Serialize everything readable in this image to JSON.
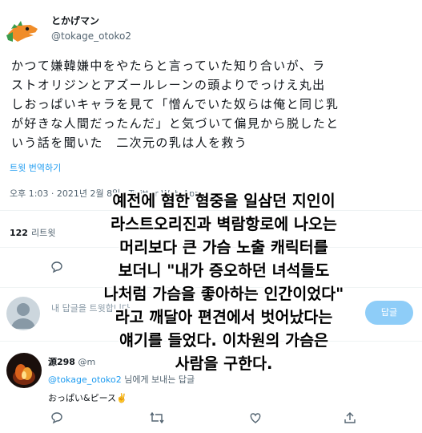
{
  "tweet": {
    "author_name": "とかげマン",
    "author_handle": "@tokage_otoko2",
    "text": "かつて嫌韓嫌中をやたらと言っていた知り合いが、ラ\nストオリジンとアズールレーンの頭よりでっけえ丸出\nしおっぱいキャラを見て「憎んでいた奴らは俺と同じ乳\nが好きな人間だったんだ」と気づいて偏見から脱したと\nいう話を聞いた　二次元の乳は人を救う",
    "translate_label": "트윗 번역하기",
    "timestamp": "오후 1:03 · 2021년 2월 8일 · Twitter Web App",
    "retweet_count": "122",
    "retweet_label": "리트윗"
  },
  "overlay": {
    "translation_text": "예전에 혐한 혐중을 일삼던 지인이\n라스트오리진과 벽람항로에 나오는\n머리보다 큰 가슴 노출 캐릭터를\n보더니 \"내가 증오하던 녀석들도\n나처럼 가슴을 좋아하는 인간이었다\"\n라고 깨달아 편견에서 벗어났다는\n얘기를 들었다. 이차원의 가슴은\n사람을 구한다."
  },
  "compose": {
    "placeholder": "내 답글을 트윗합니다",
    "reply_button": "답글"
  },
  "reply": {
    "name": "源298",
    "handle": "@m",
    "to_handle": "@tokage_otoko2",
    "to_suffix": " 님에게 보내는 답글",
    "text": "おっぱい&ピース✌️"
  },
  "icons": [
    "comment-icon",
    "retweet-icon",
    "like-icon",
    "share-icon"
  ],
  "colors": {
    "accent": "#1d9bf0",
    "muted": "#536471",
    "reply_button": "#8ecdf8"
  }
}
